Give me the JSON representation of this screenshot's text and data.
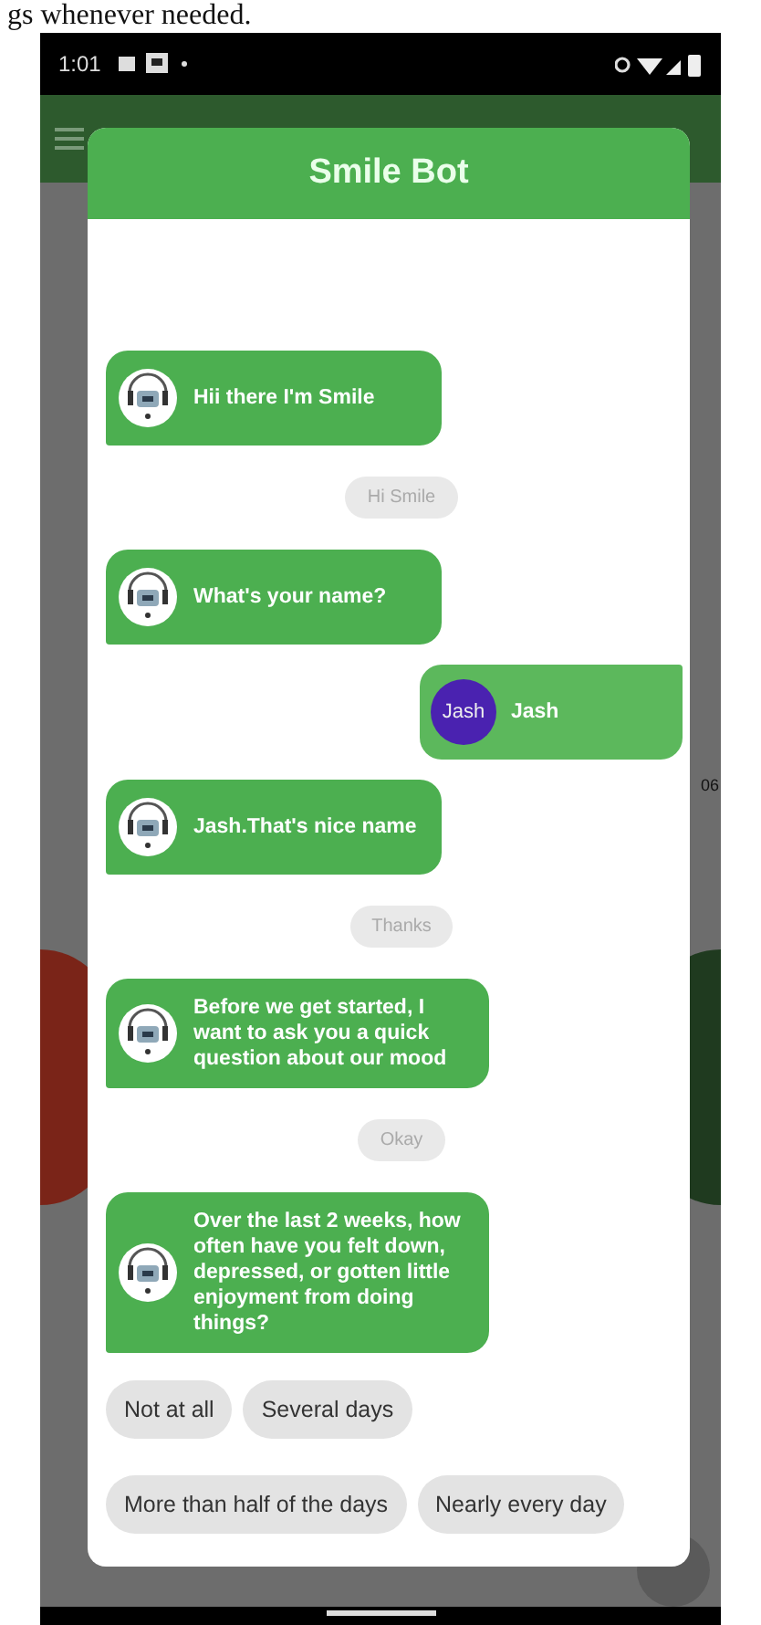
{
  "top_text": "gs whenever needed.",
  "status_bar": {
    "time": "1:01"
  },
  "background": {
    "side_text": "06"
  },
  "dialog": {
    "title": "Smile Bot",
    "messages": [
      {
        "kind": "bot",
        "text": "Hii there I'm Smile"
      },
      {
        "kind": "reply",
        "text": "Hi Smile"
      },
      {
        "kind": "bot",
        "text": "What's your name?"
      },
      {
        "kind": "user",
        "avatar": "Jash",
        "text": "Jash"
      },
      {
        "kind": "bot",
        "text": "Jash.That's nice name"
      },
      {
        "kind": "reply",
        "text": "Thanks"
      },
      {
        "kind": "bot",
        "text": "Before we get started, I want to ask you a quick question about our mood"
      },
      {
        "kind": "reply",
        "text": "Okay"
      },
      {
        "kind": "bot",
        "text": "Over the last 2 weeks, how often have you felt down, depressed, or gotten little enjoyment from doing things?"
      }
    ],
    "options": [
      "Not at all",
      "Several days",
      "More than half of the days",
      "Nearly every day"
    ]
  }
}
